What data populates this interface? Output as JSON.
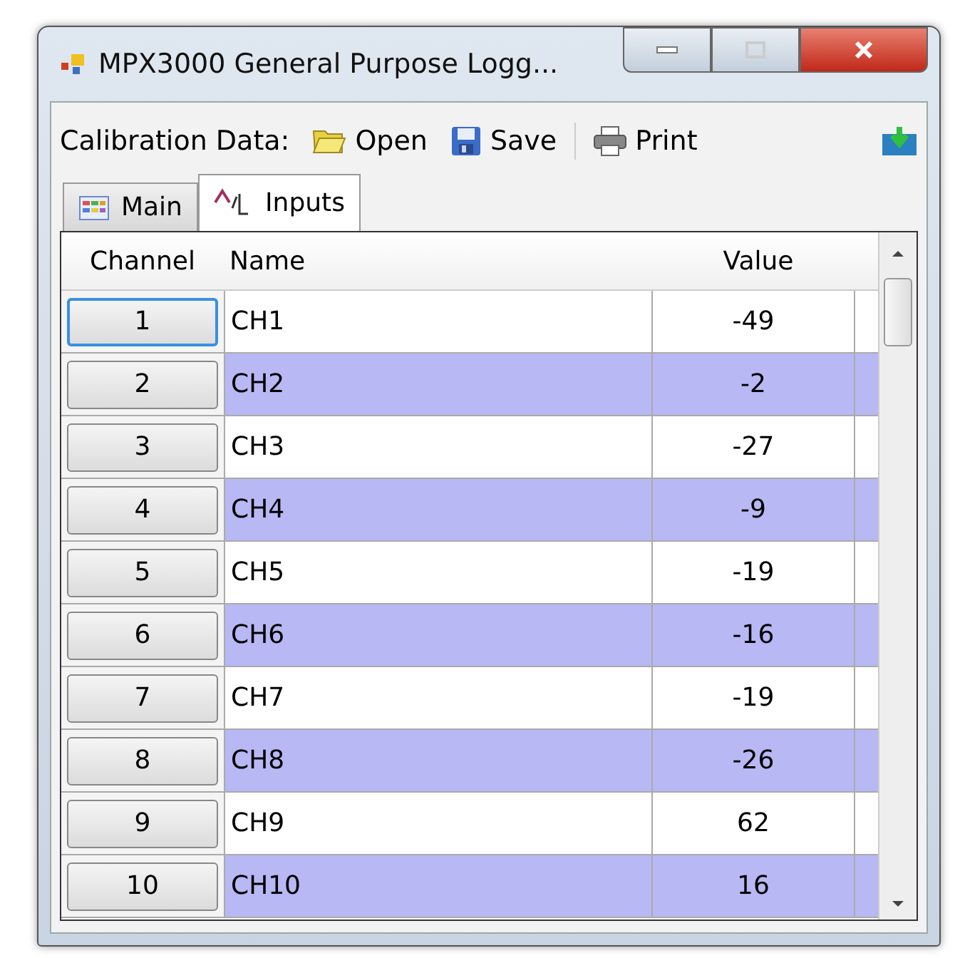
{
  "window": {
    "title": "MPX3000 General Purpose Logg..."
  },
  "toolbar": {
    "label": "Calibration Data:",
    "buttons": [
      {
        "label": "Open",
        "kind": "open"
      },
      {
        "label": "Save",
        "kind": "save"
      },
      {
        "label": "Print",
        "kind": "print"
      }
    ]
  },
  "tabs": [
    {
      "label": "Main",
      "kind": "main",
      "selected": false
    },
    {
      "label": "Inputs",
      "kind": "inputs",
      "selected": true
    }
  ],
  "table": {
    "columns": [
      "Channel",
      "Name",
      "Value"
    ],
    "rows": [
      {
        "channel": "1",
        "name": "CH1",
        "value": "-49",
        "focused": true
      },
      {
        "channel": "2",
        "name": "CH2",
        "value": "-2",
        "focused": false
      },
      {
        "channel": "3",
        "name": "CH3",
        "value": "-27",
        "focused": false
      },
      {
        "channel": "4",
        "name": "CH4",
        "value": "-9",
        "focused": false
      },
      {
        "channel": "5",
        "name": "CH5",
        "value": "-19",
        "focused": false
      },
      {
        "channel": "6",
        "name": "CH6",
        "value": "-16",
        "focused": false
      },
      {
        "channel": "7",
        "name": "CH7",
        "value": "-19",
        "focused": false
      },
      {
        "channel": "8",
        "name": "CH8",
        "value": "-26",
        "focused": false
      },
      {
        "channel": "9",
        "name": "CH9",
        "value": "62",
        "focused": false
      },
      {
        "channel": "10",
        "name": "CH10",
        "value": "16",
        "focused": false
      }
    ]
  }
}
